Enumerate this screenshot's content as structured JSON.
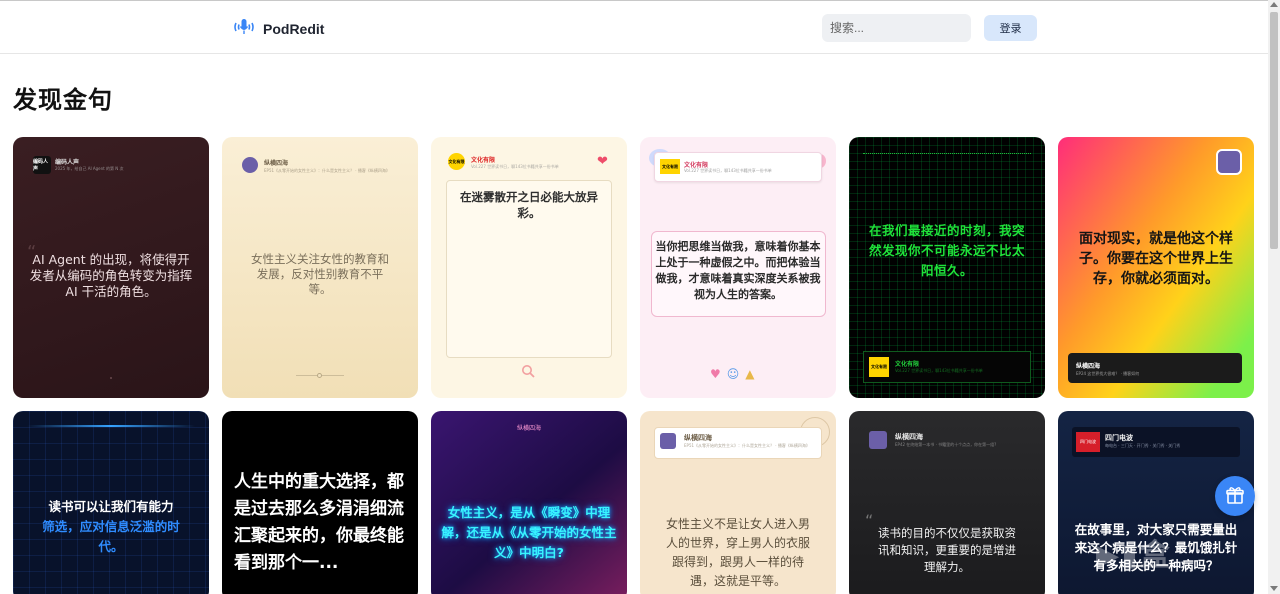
{
  "header": {
    "brand": "PodRedit",
    "search_placeholder": "搜索...",
    "login_label": "登录"
  },
  "page": {
    "title": "发现金句"
  },
  "cards_row1": [
    {
      "name": "编码人声",
      "meta": "2025 年，给自己 AI Agent 的第 N 次",
      "avatar_text": "编码人声",
      "quote": "AI Agent 的出现，将使得开发者从编码的角色转变为指挥 AI 干活的角色。"
    },
    {
      "name": "纵横四海",
      "meta": "EP51《从零开始的女性主义》：什么是女性主义？ · 播客《纵横四海》",
      "quote": "女性主义关注女性的教育和发展，反对性别教育不平等。"
    },
    {
      "name": "文化有限",
      "meta": "Vol.227 世界读书日，聊143位书籍共享一份书单",
      "avatar_text": "文化有限",
      "quote": "在迷雾散开之日必能大放异彩。"
    },
    {
      "name": "文化有限",
      "meta": "Vol.227 世界读书日，聊143位书籍共享一份书单",
      "avatar_text": "文化有限",
      "quote": "当你把思维当做我，意味着你基本上处于一种虚假之中。而把体验当做我，才意味着真实深度关系被我视为人生的答案。"
    },
    {
      "name": "文化有限",
      "meta": "Vol.227 世界读书日，聊143位书籍共享一份书单",
      "avatar_text": "文化有限",
      "quote": "在我们最接近的时刻，我突然发现你不可能永远不比太阳恒久。"
    },
    {
      "name": "纵横四海",
      "meta": "EP24 这世界找大很难？ · 播客如何",
      "quote": "面对现实，就是他这个样子。你要在这个世界上生存，你就必须面对。"
    }
  ],
  "cards_row2": [
    {
      "quote_a": "读书可以让我们有能力",
      "quote_b": "筛选，应对信息泛滥的时代。"
    },
    {
      "quote": "人生中的重大选择，都是过去那么多涓涓细流汇聚起来的，你最终能看到那个一..."
    },
    {
      "tag": "纵横四海",
      "quote": "女性主义，是从《瞬变》中理解，还是从《从零开始的女性主义》中明白?"
    },
    {
      "name": "纵横四海",
      "meta": "EP51《从零开始的女性主义》：什么是女性主义？ · 播客《纵横四海》",
      "quote": "女性主义不是让女人进入男人的世界，穿上男人的衣服跟得到，跟男人一样的待遇，这就是平等。"
    },
    {
      "name": "纵横四海",
      "meta": "EP42 在终结第一本书 · 书籍里的十个点点，你在第一组?",
      "quote": "读书的目的不仅仅是获取资讯和知识，更重要的是增进理解力。"
    },
    {
      "name": "四门电波",
      "meta": "每电台 · 三门天 · 开门秀 · 关门秀 · 关门秀",
      "avatar_text": "四门电波",
      "quote": "在故事里，对大家只需要量出来这个病是什么？最饥饿扎针有多相关的一种病吗？"
    }
  ],
  "colors": {
    "accent": "#3a86f6",
    "login_bg": "#d8e7fb",
    "heart": "#ee4d6a",
    "terminal_green": "#1fe23a",
    "neon_cyan": "#38f4ff"
  },
  "icons": {
    "brand": "microphone-icon",
    "favorite": "heart-icon",
    "search": "magnifier-icon",
    "gift": "gift-icon"
  }
}
